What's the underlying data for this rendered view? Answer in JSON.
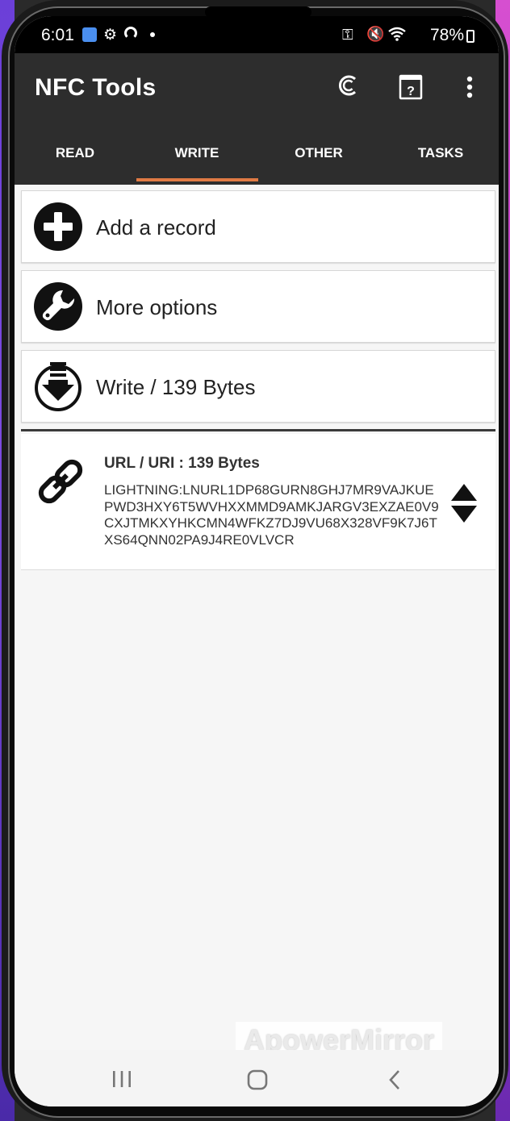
{
  "status": {
    "time": "6:01",
    "battery": "78%"
  },
  "app": {
    "title": "NFC Tools"
  },
  "tabs": [
    {
      "label": "READ"
    },
    {
      "label": "WRITE",
      "active": true
    },
    {
      "label": "OTHER"
    },
    {
      "label": "TASKS"
    }
  ],
  "actions": {
    "add_record": "Add a record",
    "more_options": "More options",
    "write": "Write / 139 Bytes"
  },
  "record": {
    "title": "URL / URI : 139 Bytes",
    "value": "LIGHTNING:LNURL1DP68GURN8GHJ7MR9VAJKUEPWD3HXY6T5WVHXXMMD9AMKJARGV3EXZAE0V9CXJTMKXYHKCMN4WFKZ7DJ9VU68X328VF9K7J6TXS64QNN02PA9J4RE0VLVCR"
  },
  "watermark": "ApowerMirror",
  "colors": {
    "appbar": "#2d2d2d",
    "tab_indicator": "#e07a44",
    "background": "#f6f6f6"
  },
  "icons": [
    "plus-circle-icon",
    "wrench-icon",
    "download-icon",
    "link-icon",
    "reorder-arrows-icon",
    "crypto-icon",
    "help-icon",
    "more-vert-icon"
  ]
}
